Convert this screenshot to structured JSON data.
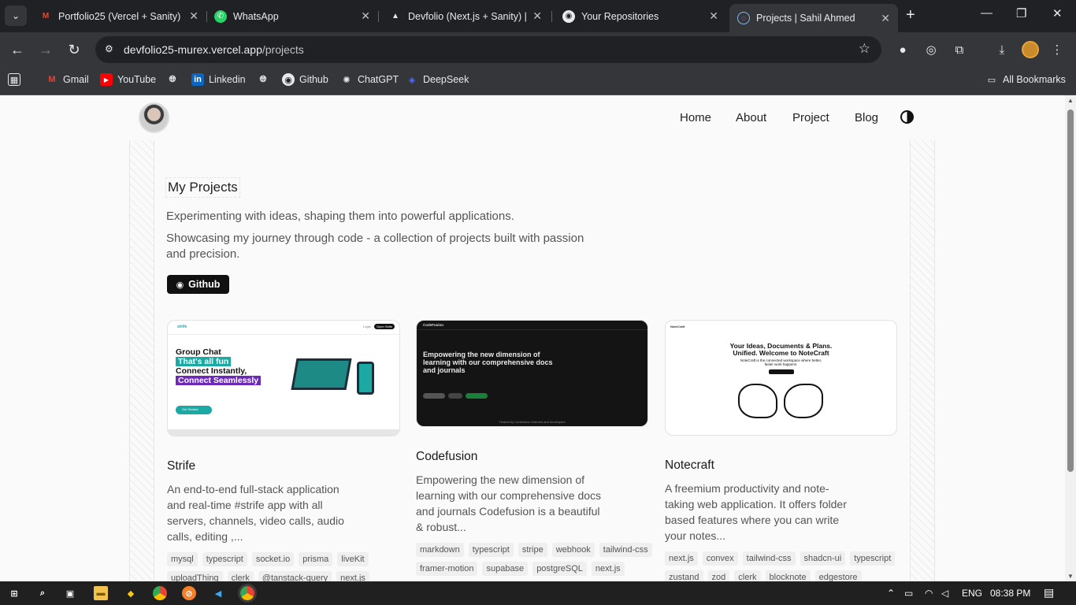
{
  "browser": {
    "tabs": [
      {
        "title": "Portfolio25 (Vercel + Sanity) - ",
        "icon": "gmail-icon",
        "active": false
      },
      {
        "title": "WhatsApp",
        "icon": "whatsapp-icon",
        "active": false
      },
      {
        "title": "Devfolio (Next.js + Sanity) | s",
        "icon": "vercel-icon",
        "active": false
      },
      {
        "title": "Your Repositories",
        "icon": "github-icon",
        "active": false
      },
      {
        "title": "Projects | Sahil Ahmed",
        "icon": "site-icon",
        "active": true
      }
    ],
    "url_host": "devfolio25-murex.vercel.app",
    "url_path": "/projects",
    "bookmarks": [
      {
        "label": "Gmail",
        "icon": "gmail-icon"
      },
      {
        "label": "YouTube",
        "icon": "youtube-icon"
      },
      {
        "label": "",
        "icon": "globe-icon"
      },
      {
        "label": "Linkedin",
        "icon": "linkedin-icon"
      },
      {
        "label": "",
        "icon": "globe-icon"
      },
      {
        "label": "Github",
        "icon": "github-icon"
      },
      {
        "label": "ChatGPT",
        "icon": "chatgpt-icon"
      },
      {
        "label": "DeepSeek",
        "icon": "deepseek-icon"
      }
    ],
    "all_bookmarks": "All Bookmarks"
  },
  "site": {
    "nav": [
      "Home",
      "About",
      "Project",
      "Blog"
    ],
    "heading": "My Projects",
    "intro": "Experimenting with ideas, shaping them into powerful applications.",
    "intro2": "Showcasing my journey through code - a collection of projects built with passion and precision.",
    "github_button": "Github"
  },
  "projects": [
    {
      "title": "Strife",
      "description": "An end-to-end full-stack application and real-time #strife app with all servers, channels, video calls, audio calls, editing ,...",
      "tags": [
        "mysql",
        "typescript",
        "socket.io",
        "prisma",
        "liveKit",
        "uploadThing",
        "clerk",
        "@tanstack-query",
        "next.js"
      ],
      "thumb": {
        "brand": "strife",
        "login": "Login",
        "open": "Open Strife",
        "line1": "Group Chat",
        "line2": "That's all fun",
        "line3": "Connect Instantly,",
        "line4": "Connect Seamlessly",
        "cta": "Get Started"
      }
    },
    {
      "title": "Codefusion",
      "description": "Empowering the new dimension of learning with our comprehensive docs and journals Codefusion is a beautiful & robust...",
      "tags": [
        "markdown",
        "typescript",
        "stripe",
        "webhook",
        "tailwind-css",
        "framer-motion",
        "supabase",
        "postgreSQL",
        "next.js"
      ],
      "thumb": {
        "brand": "CodeFusion",
        "headline": "Empowering the new dimension of learning with our comprehensive docs and journals",
        "footer": "Trusted by Codefusion learners and developers"
      }
    },
    {
      "title": "Notecraft",
      "description": "A freemium productivity and note-taking web application. It offers folder based features where you can write your notes...",
      "tags": [
        "next.js",
        "convex",
        "tailwind-css",
        "shadcn-ui",
        "typescript",
        "zustand",
        "zod",
        "clerk",
        "blocknote",
        "edgestore"
      ],
      "thumb": {
        "brand": "NoteCraft",
        "headline1": "Your Ideas, Documents & Plans.",
        "headline2": "Unified. Welcome to NoteCraft",
        "sub": "NoteCraft is the connected workspace where better, faster work happens."
      }
    }
  ],
  "taskbar": {
    "lang": "ENG",
    "time": "08:38 PM"
  }
}
